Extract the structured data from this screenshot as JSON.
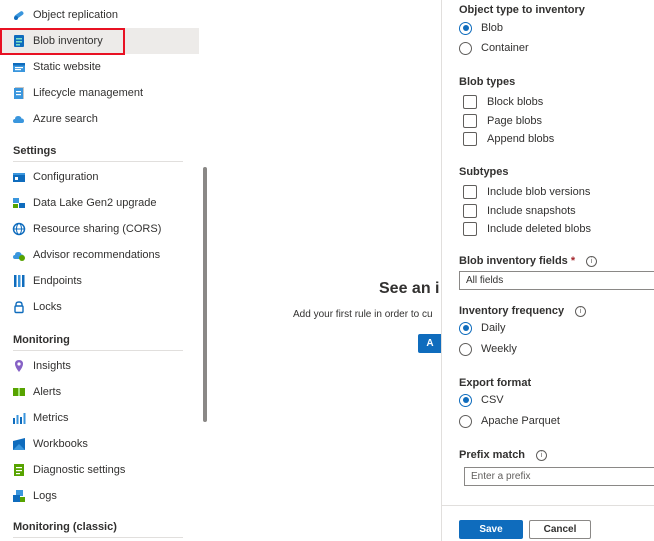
{
  "sidebar": {
    "items": [
      {
        "label": "Object replication",
        "icon": "object-replication-icon"
      },
      {
        "label": "Blob inventory",
        "icon": "blob-inventory-icon",
        "selected": true
      },
      {
        "label": "Static website",
        "icon": "static-website-icon"
      },
      {
        "label": "Lifecycle management",
        "icon": "lifecycle-management-icon"
      },
      {
        "label": "Azure search",
        "icon": "azure-search-icon"
      }
    ],
    "settings_header": "Settings",
    "settings_items": [
      {
        "label": "Configuration",
        "icon": "configuration-icon"
      },
      {
        "label": "Data Lake Gen2 upgrade",
        "icon": "data-lake-icon"
      },
      {
        "label": "Resource sharing (CORS)",
        "icon": "cors-icon"
      },
      {
        "label": "Advisor recommendations",
        "icon": "advisor-icon"
      },
      {
        "label": "Endpoints",
        "icon": "endpoints-icon"
      },
      {
        "label": "Locks",
        "icon": "lock-icon"
      }
    ],
    "monitoring_header": "Monitoring",
    "monitoring_items": [
      {
        "label": "Insights",
        "icon": "insights-icon"
      },
      {
        "label": "Alerts",
        "icon": "alerts-icon"
      },
      {
        "label": "Metrics",
        "icon": "metrics-icon"
      },
      {
        "label": "Workbooks",
        "icon": "workbooks-icon"
      },
      {
        "label": "Diagnostic settings",
        "icon": "diagnostic-settings-icon"
      },
      {
        "label": "Logs",
        "icon": "logs-icon"
      }
    ],
    "monitoring_classic_header": "Monitoring (classic)"
  },
  "center": {
    "title": "See an i",
    "subtitle": "Add your first rule in order to cu",
    "button_label": "A"
  },
  "panel": {
    "object_type": {
      "header": "Object type to inventory",
      "options": [
        {
          "label": "Blob",
          "checked": true
        },
        {
          "label": "Container",
          "checked": false
        }
      ]
    },
    "blob_types": {
      "header": "Blob types",
      "options": [
        {
          "label": "Block blobs"
        },
        {
          "label": "Page blobs"
        },
        {
          "label": "Append blobs"
        }
      ]
    },
    "subtypes": {
      "header": "Subtypes",
      "options": [
        {
          "label": "Include blob versions"
        },
        {
          "label": "Include snapshots"
        },
        {
          "label": "Include deleted blobs"
        }
      ]
    },
    "fields": {
      "header": "Blob inventory fields",
      "required": "*",
      "value": "All fields"
    },
    "frequency": {
      "header": "Inventory frequency",
      "options": [
        {
          "label": "Daily",
          "checked": true
        },
        {
          "label": "Weekly",
          "checked": false
        }
      ]
    },
    "export_format": {
      "header": "Export format",
      "options": [
        {
          "label": "CSV",
          "checked": true
        },
        {
          "label": "Apache Parquet",
          "checked": false
        }
      ]
    },
    "prefix": {
      "header": "Prefix match",
      "placeholder": "Enter a prefix"
    },
    "save_label": "Save",
    "cancel_label": "Cancel"
  },
  "colors": {
    "accent": "#0f6cbd",
    "selection_outline": "#e81123",
    "selected_bg": "#edebe9"
  }
}
